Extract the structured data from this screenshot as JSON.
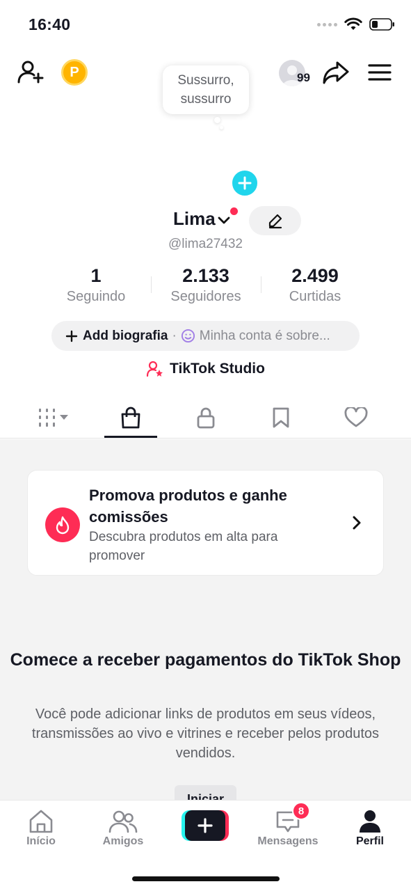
{
  "status_bar": {
    "time": "16:40"
  },
  "header": {
    "coin_letter": "P",
    "friends_count": "99"
  },
  "profile": {
    "bubble_line1": "Sussurro,",
    "bubble_line2": "sussurro",
    "name": "Lima",
    "handle": "@lima27432"
  },
  "stats": [
    {
      "value": "1",
      "label": "Seguindo"
    },
    {
      "value": "2.133",
      "label": "Seguidores"
    },
    {
      "value": "2.499",
      "label": "Curtidas"
    }
  ],
  "bio": {
    "add_label": "Add biografia",
    "separator": "·",
    "hint": "Minha conta é sobre..."
  },
  "studio": {
    "label": "TikTok Studio"
  },
  "tabs": [
    "videos-grid",
    "shop",
    "private",
    "favorites",
    "liked"
  ],
  "promo": {
    "title": "Promova produtos e ganhe comissões",
    "subtitle": "Descubra produtos em alta para promover"
  },
  "shop_cta": {
    "title": "Comece a receber pagamentos do TikTok Shop",
    "description": "Você pode adicionar links de produtos em seus vídeos, transmissões ao vivo e vitrines e receber pelos produtos vendidos.",
    "button_label": "Iniciar"
  },
  "bottom_nav": [
    {
      "label": "Início",
      "icon": "home-icon"
    },
    {
      "label": "Amigos",
      "icon": "friends-icon"
    },
    {
      "label": "",
      "icon": "plus-icon"
    },
    {
      "label": "Mensagens",
      "icon": "inbox-icon",
      "badge": "8"
    },
    {
      "label": "Perfil",
      "icon": "profile-icon",
      "active": true
    }
  ],
  "colors": {
    "brand_pink": "#fe2c55",
    "brand_cyan": "#20d5ec",
    "coin": "#ffb400"
  }
}
